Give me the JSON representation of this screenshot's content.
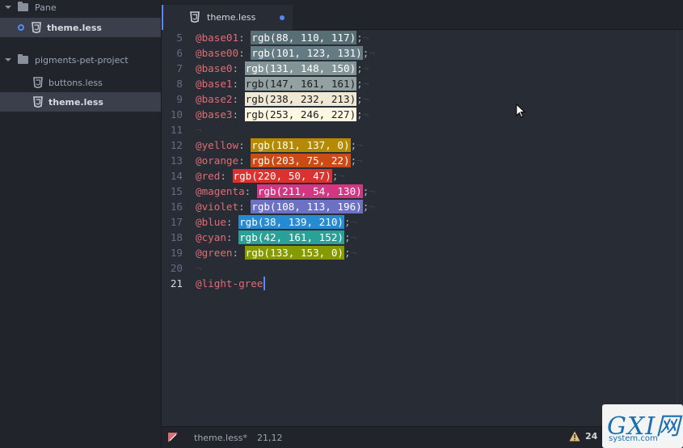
{
  "sidebar": {
    "items": [
      {
        "kind": "folder-expanded",
        "label": "Pane",
        "icon": "folder-icon"
      },
      {
        "kind": "file-open",
        "label": "theme.less",
        "icon": "css3-icon",
        "selected": true
      },
      {
        "kind": "folder-expanded",
        "label": "pigments-pet-project",
        "icon": "folder-icon"
      },
      {
        "kind": "file",
        "label": "buttons.less",
        "icon": "css3-icon"
      },
      {
        "kind": "file",
        "label": "theme.less",
        "icon": "css3-icon",
        "selected": true
      }
    ]
  },
  "tabs": [
    {
      "label": "theme.less",
      "icon": "css3-icon",
      "modified": true,
      "active": true
    }
  ],
  "editor": {
    "lines": [
      {
        "n": "5",
        "name": "@base01",
        "value": "rgb(88, 110, 117)",
        "color": "#586e75",
        "fg": "#ffffff"
      },
      {
        "n": "6",
        "name": "@base00",
        "value": "rgb(101, 123, 131)",
        "color": "#657b83",
        "fg": "#ffffff"
      },
      {
        "n": "7",
        "name": "@base0",
        "value": "rgb(131, 148, 150)",
        "color": "#839496",
        "fg": "#ffffff"
      },
      {
        "n": "8",
        "name": "@base1",
        "value": "rgb(147, 161, 161)",
        "color": "#93a1a1",
        "fg": "#1c1c1c"
      },
      {
        "n": "9",
        "name": "@base2",
        "value": "rgb(238, 232, 213)",
        "color": "#eee8d5",
        "fg": "#1c1c1c"
      },
      {
        "n": "10",
        "name": "@base3",
        "value": "rgb(253, 246, 227)",
        "color": "#fdf6e3",
        "fg": "#1c1c1c"
      },
      {
        "n": "11",
        "name": "",
        "value": "",
        "color": "",
        "fg": ""
      },
      {
        "n": "12",
        "name": "@yellow",
        "value": "rgb(181, 137, 0)",
        "color": "#b58900",
        "fg": "#ffffff"
      },
      {
        "n": "13",
        "name": "@orange",
        "value": "rgb(203, 75, 22)",
        "color": "#cb4b16",
        "fg": "#ffffff"
      },
      {
        "n": "14",
        "name": "@red",
        "value": "rgb(220, 50, 47)",
        "color": "#dc322f",
        "fg": "#ffffff"
      },
      {
        "n": "15",
        "name": "@magenta",
        "value": "rgb(211, 54, 130)",
        "color": "#d33682",
        "fg": "#ffffff"
      },
      {
        "n": "16",
        "name": "@violet",
        "value": "rgb(108, 113, 196)",
        "color": "#6c71c4",
        "fg": "#ffffff"
      },
      {
        "n": "17",
        "name": "@blue",
        "value": "rgb(38, 139, 210)",
        "color": "#268bd2",
        "fg": "#ffffff"
      },
      {
        "n": "18",
        "name": "@cyan",
        "value": "rgb(42, 161, 152)",
        "color": "#2aa198",
        "fg": "#ffffff"
      },
      {
        "n": "19",
        "name": "@green",
        "value": "rgb(133, 153, 0)",
        "color": "#859900",
        "fg": "#ffffff"
      },
      {
        "n": "20",
        "name": "",
        "value": "",
        "color": "",
        "fg": ""
      },
      {
        "n": "21",
        "name": "@light-gree",
        "value": "",
        "color": "",
        "fg": "",
        "current": true
      }
    ]
  },
  "statusbar": {
    "file": "theme.less*",
    "cursor": "21,12",
    "warnings": "24"
  },
  "watermark": {
    "logo": "GXI网",
    "sub": "system.com"
  },
  "colors": {
    "accent": "#568af2",
    "variable": "#e06c75",
    "warning": "#e5c07b"
  }
}
